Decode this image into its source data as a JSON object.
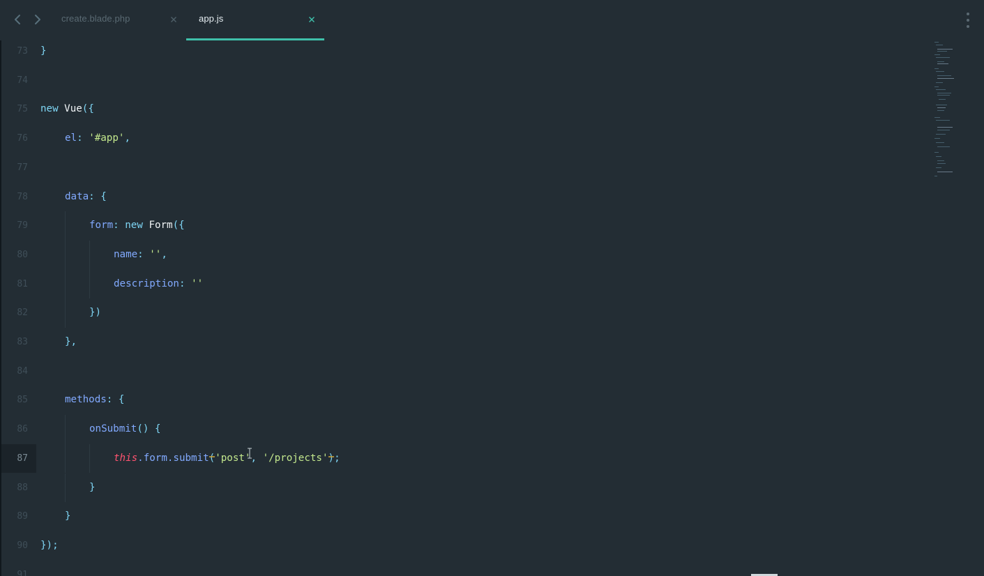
{
  "tabs": [
    {
      "label": "create.blade.php",
      "active": false
    },
    {
      "label": "app.js",
      "active": true
    }
  ],
  "icons": {
    "back": "chevron-left-icon",
    "forward": "chevron-right-icon",
    "close": "close-icon",
    "more": "vertical-ellipsis-icon"
  },
  "colors": {
    "background": "#232d34",
    "active_tab_indicator": "#3fc0aa",
    "keyword": "#7fd6f5",
    "property": "#82aaff",
    "string": "#c3e88d",
    "this": "#ff5370"
  },
  "current_line": "87",
  "editor": {
    "lines": [
      {
        "number": "73",
        "text": "}"
      },
      {
        "number": "74",
        "text": ""
      },
      {
        "number": "75",
        "text": "new Vue({"
      },
      {
        "number": "76",
        "text": "el: '#app',"
      },
      {
        "number": "77",
        "text": ""
      },
      {
        "number": "78",
        "text": "data: {"
      },
      {
        "number": "79",
        "text": "form: new Form({"
      },
      {
        "number": "80",
        "text": "name: '',"
      },
      {
        "number": "81",
        "text": "description: ''"
      },
      {
        "number": "82",
        "text": "})"
      },
      {
        "number": "83",
        "text": "},"
      },
      {
        "number": "84",
        "text": ""
      },
      {
        "number": "85",
        "text": "methods: {"
      },
      {
        "number": "86",
        "text": "onSubmit() {"
      },
      {
        "number": "87",
        "text": "this.form.submit('post', '/projects');"
      },
      {
        "number": "88",
        "text": "}"
      },
      {
        "number": "89",
        "text": "}"
      },
      {
        "number": "90",
        "text": "});"
      },
      {
        "number": "91",
        "text": ""
      }
    ],
    "tokens": {
      "l73": [
        "}"
      ],
      "l75": [
        "new",
        "Vue",
        "({"
      ],
      "l76": [
        "el",
        ": ",
        "'#app'",
        ","
      ],
      "l78": [
        "data",
        ": ",
        "{"
      ],
      "l79": [
        "form",
        ": ",
        "new",
        "Form",
        "({"
      ],
      "l80": [
        "name",
        ": ",
        "''",
        ","
      ],
      "l81": [
        "description",
        ": ",
        "''"
      ],
      "l82": [
        "})"
      ],
      "l83": [
        "},"
      ],
      "l85": [
        "methods",
        ": ",
        "{"
      ],
      "l86": [
        "onSubmit",
        "() ",
        "{"
      ],
      "l87": [
        "this",
        ".form.submit",
        "(",
        "'post'",
        ", ",
        "'/projects'",
        ")",
        ";"
      ],
      "l88": [
        "}"
      ],
      "l89": [
        "}"
      ],
      "l90": [
        "});"
      ]
    }
  }
}
